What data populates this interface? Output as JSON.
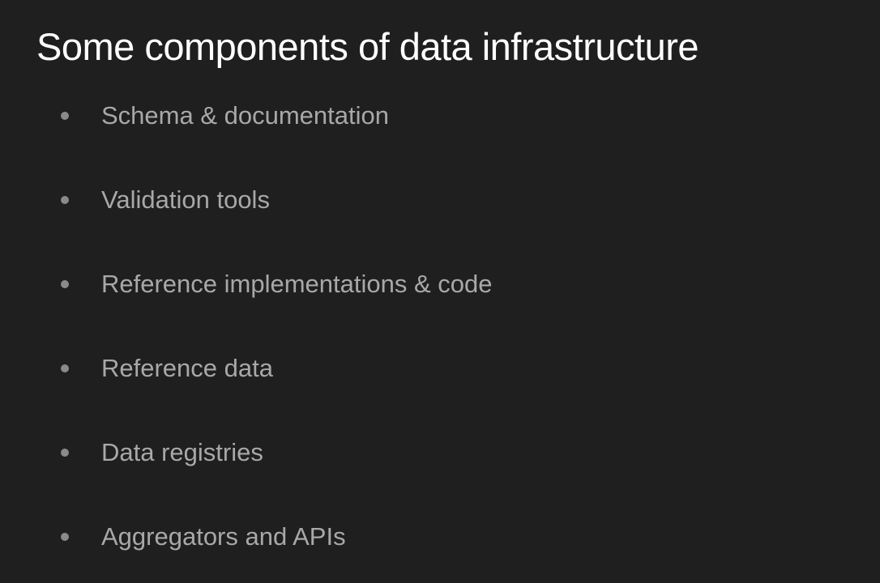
{
  "slide": {
    "title": "Some components of data infrastructure",
    "bullets": [
      "Schema & documentation",
      "Validation tools",
      "Reference implementations & code",
      "Reference data",
      "Data registries",
      "Aggregators and APIs"
    ]
  }
}
